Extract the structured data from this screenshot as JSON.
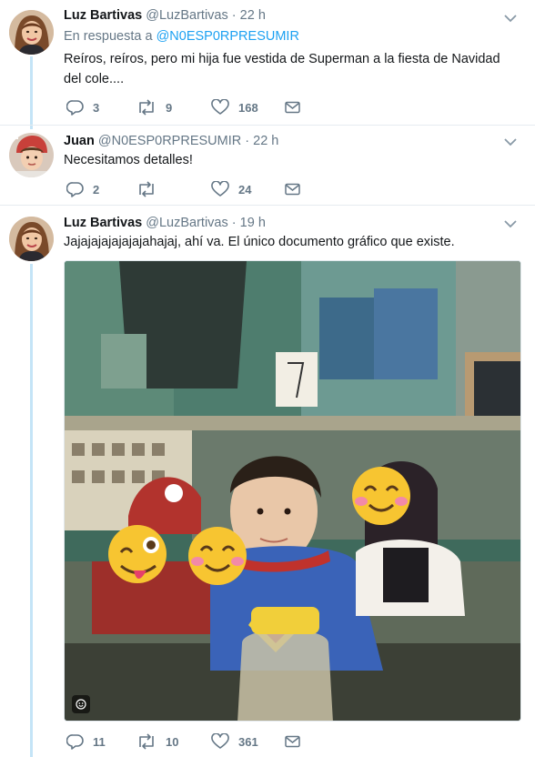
{
  "thread": [
    {
      "name": "Luz Bartivas",
      "handle": "@LuzBartivas",
      "separator": "·",
      "time": "22 h",
      "reply_prefix": "En respuesta a",
      "reply_to": "@N0ESP0RPRESUMIR",
      "text": "Reíros, reíros, pero mi hija fue vestida de Superman a la fiesta de Navidad del cole....",
      "replies": "3",
      "retweets": "9",
      "likes": "168"
    },
    {
      "name": "Juan",
      "handle": "@N0ESP0RPRESUMIR",
      "separator": "·",
      "time": "22 h",
      "text": "Necesitamos detalles!",
      "replies": "2",
      "retweets": "",
      "likes": "24"
    },
    {
      "name": "Luz Bartivas",
      "handle": "@LuzBartivas",
      "separator": "·",
      "time": "19 h",
      "text": "Jajajajajajajajahajaj, ahí va. El único documento gráfico que existe.",
      "replies": "11",
      "retweets": "10",
      "likes": "361"
    }
  ],
  "icons": {
    "reply": "reply-icon",
    "retweet": "retweet-icon",
    "like": "heart-icon",
    "dm": "envelope-icon",
    "more": "chevron-down-icon",
    "media": "smiley-badge-icon"
  },
  "colors": {
    "link": "#1da1f2",
    "secondary_text": "#657786",
    "thread_line": "#c4e4f7",
    "divider": "#e6ecf0"
  }
}
